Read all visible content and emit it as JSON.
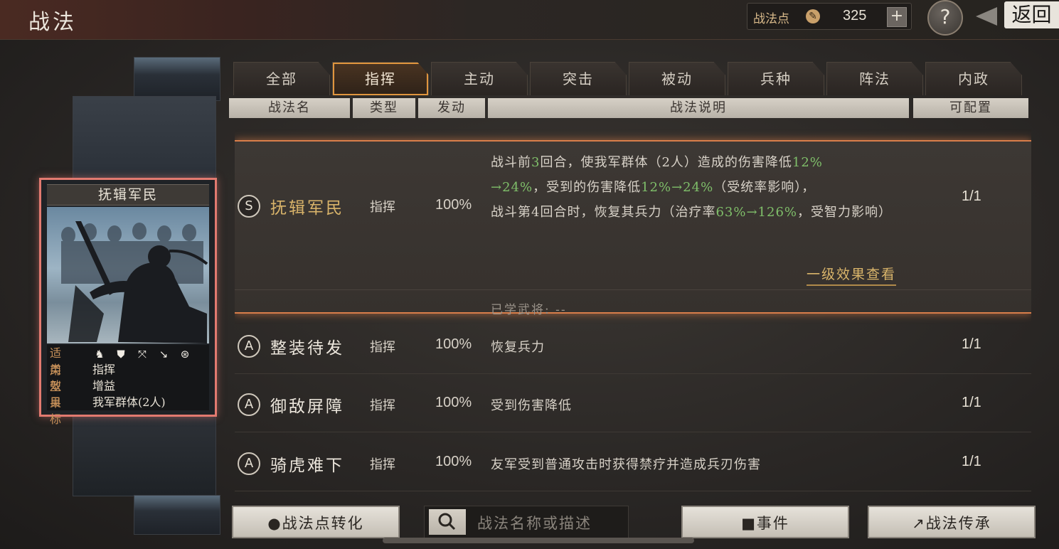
{
  "header": {
    "title": "战法",
    "points_label": "战法点",
    "points_value": "325",
    "plus_label": "+",
    "help_label": "?",
    "back_label": "返回"
  },
  "selected_card": {
    "title": "抚辑军民",
    "rows": [
      {
        "key": "适用",
        "value": ""
      },
      {
        "key": "类型",
        "value": "指挥"
      },
      {
        "key": "效果",
        "value": "增益"
      },
      {
        "key": "目标",
        "value": "我军群体(2人)"
      }
    ],
    "troop_icons": [
      "cavalry-icon",
      "shield-icon",
      "bow-icon",
      "spear-icon",
      "wheel-icon"
    ]
  },
  "tabs": [
    {
      "label": "全部",
      "active": false
    },
    {
      "label": "指挥",
      "active": true
    },
    {
      "label": "主动",
      "active": false
    },
    {
      "label": "突击",
      "active": false
    },
    {
      "label": "被动",
      "active": false
    },
    {
      "label": "兵种",
      "active": false
    },
    {
      "label": "阵法",
      "active": false
    },
    {
      "label": "内政",
      "active": false
    }
  ],
  "columns": {
    "name": "战法名",
    "type": "类型",
    "trigger": "发动",
    "desc": "战法说明",
    "config": "可配置"
  },
  "expanded": {
    "grade": "S",
    "name": "抚辑军民",
    "type": "指挥",
    "rate": "100%",
    "config": "1/1",
    "desc_parts": {
      "p1": "战斗前",
      "n1": "3",
      "p2": "回合，使我军群体（2人）造成的伤害降低",
      "n2": "12%",
      "n3": "→24%",
      "p3": "，受到的伤害降低",
      "n4": "12%→24%",
      "p4": "（受统率影响），",
      "p5": "战斗第4回合时，恢复其兵力（治疗率",
      "n5": "63%→126%",
      "p6": "，受智力影响）"
    },
    "link": "一级效果查看",
    "learned": "已学武将: --"
  },
  "rows": [
    {
      "grade": "A",
      "name": "整装待发",
      "type": "指挥",
      "rate": "100%",
      "desc": "恢复兵力",
      "config": "1/1"
    },
    {
      "grade": "A",
      "name": "御敌屏障",
      "type": "指挥",
      "rate": "100%",
      "desc": "受到伤害降低",
      "config": "1/1"
    },
    {
      "grade": "A",
      "name": "骑虎难下",
      "type": "指挥",
      "rate": "100%",
      "desc": "友军受到普通攻击时获得禁疗并造成兵刃伤害",
      "config": "1/1"
    }
  ],
  "bottom": {
    "convert": "战法点转化",
    "search_placeholder": "战法名称或描述",
    "events": "事件",
    "inherit": "战法传承"
  },
  "colors": {
    "accent": "#e0953e",
    "highlight_green": "#7fbf6a",
    "gold": "#d9b46a",
    "card_border": "#e27a70"
  }
}
